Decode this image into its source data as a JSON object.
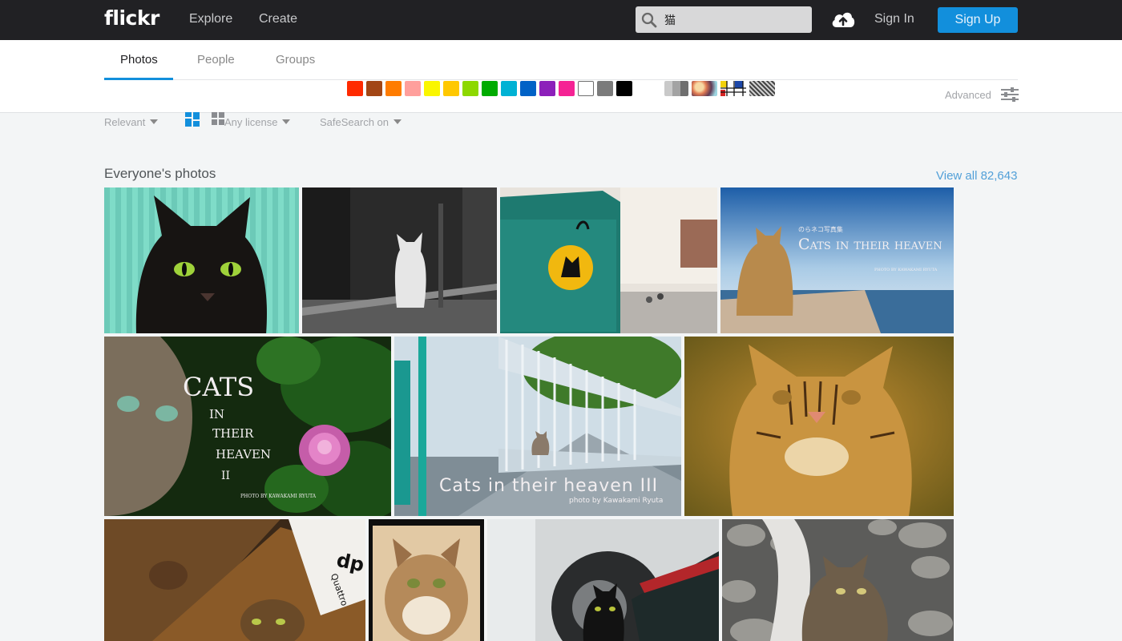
{
  "header": {
    "logo": "flickr",
    "nav": [
      "Explore",
      "Create"
    ],
    "search": {
      "value": "猫"
    },
    "sign_in": "Sign In",
    "sign_up": "Sign Up"
  },
  "tabs": [
    {
      "label": "Photos",
      "active": true
    },
    {
      "label": "People",
      "active": false
    },
    {
      "label": "Groups",
      "active": false
    }
  ],
  "color_filters": [
    "#ff2a00",
    "#a24615",
    "#ff7c00",
    "#ff9f9c",
    "#faf600",
    "#ffc800",
    "#8dd800",
    "#00ab00",
    "#00b2d4",
    "#0062c6",
    "#8c20ba",
    "#f52394",
    "#ffffff",
    "#7b7b7b",
    "#000000"
  ],
  "style_filters": [
    "black-and-white",
    "shallow-depth-of-field",
    "minimalist",
    "patterns"
  ],
  "advanced_label": "Advanced",
  "filters": {
    "sort": "Relevant",
    "license": "Any license",
    "safesearch": "SafeSearch on"
  },
  "section": {
    "title": "Everyone's photos",
    "view_all": "View all 82,643"
  },
  "photo_texts": {
    "p4_small": "のらネコ写真集",
    "p4_title": "Cats in their heaven",
    "p4_credit": "PHOTO BY KAWAKAMI RYUTA",
    "p5_title": "CATS",
    "p5_in": "IN",
    "p5_their": "THEIR",
    "p5_heaven": "HEAVEN",
    "p5_num": "II",
    "p5_credit": "PHOTO BY KAWAKAMI RYUTA",
    "p6_title": "Cats in their heaven III",
    "p6_credit": "photo by Kawakami Ryuta",
    "p9_brand": "dp",
    "p9_model": "Quattro"
  }
}
